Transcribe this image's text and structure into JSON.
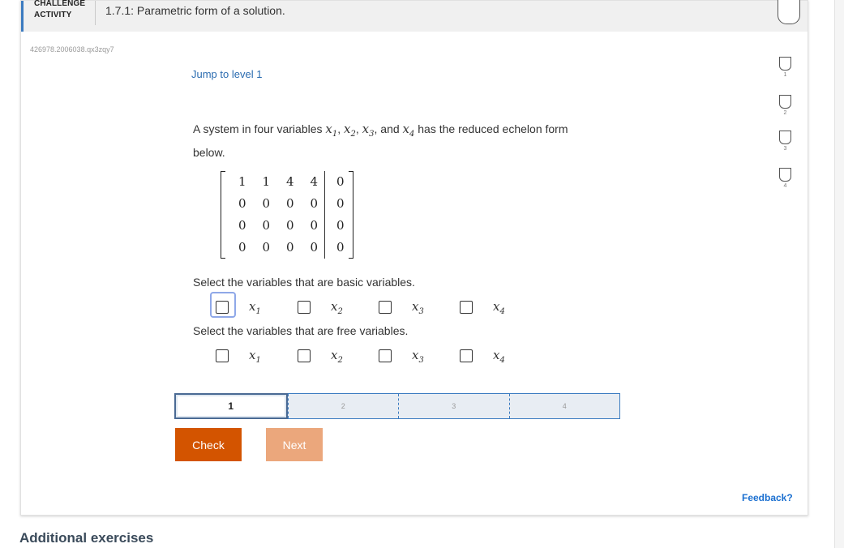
{
  "header": {
    "label_line1": "CHALLENGE",
    "label_line2": "ACTIVITY",
    "title": "1.7.1: Parametric form of a solution."
  },
  "activity_id": "426978.2006038.qx3zqy7",
  "jump_link": "Jump to level 1",
  "prompt": {
    "text_start": "A system in four variables",
    "vars": [
      "x",
      "x",
      "x",
      "x"
    ],
    "subs": [
      "1",
      "2",
      "3",
      "4"
    ],
    "sep1": ",",
    "sep2": ",",
    "sep3": ", and",
    "text_end": "has the reduced echelon form below."
  },
  "matrix": [
    [
      "1",
      "1",
      "4",
      "4",
      "0"
    ],
    [
      "0",
      "0",
      "0",
      "0",
      "0"
    ],
    [
      "0",
      "0",
      "0",
      "0",
      "0"
    ],
    [
      "0",
      "0",
      "0",
      "0",
      "0"
    ]
  ],
  "basic_question": {
    "label": "Select the variables that are basic variables.",
    "options": [
      {
        "var": "x",
        "sub": "1"
      },
      {
        "var": "x",
        "sub": "2"
      },
      {
        "var": "x",
        "sub": "3"
      },
      {
        "var": "x",
        "sub": "4"
      }
    ]
  },
  "free_question": {
    "label": "Select the variables that are free variables.",
    "options": [
      {
        "var": "x",
        "sub": "1"
      },
      {
        "var": "x",
        "sub": "2"
      },
      {
        "var": "x",
        "sub": "3"
      },
      {
        "var": "x",
        "sub": "4"
      }
    ]
  },
  "levels": [
    "1",
    "2",
    "3",
    "4"
  ],
  "buttons": {
    "check": "Check",
    "next": "Next"
  },
  "side_levels": [
    "1",
    "2",
    "3",
    "4"
  ],
  "feedback": "Feedback?",
  "additional_exercises": "Additional exercises",
  "colors": {
    "accent_blue": "#3b7bc0",
    "check_orange": "#d35400",
    "next_orange_disabled": "#eba77c",
    "link_blue": "#1a6fd0"
  }
}
